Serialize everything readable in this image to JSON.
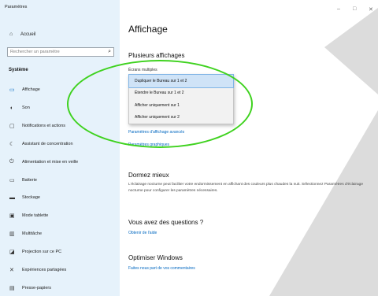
{
  "window": {
    "title": "Paramètres",
    "controls": [
      "–",
      "□",
      "✕"
    ]
  },
  "sidebar": {
    "home_label": "Accueil",
    "search_placeholder": "Rechercher un paramètre",
    "section": "Système",
    "items": [
      {
        "label": "Affichage",
        "icon": "monitor-icon"
      },
      {
        "label": "Son",
        "icon": "speaker-icon"
      },
      {
        "label": "Notifications et actions",
        "icon": "notification-icon"
      },
      {
        "label": "Assistant de concentration",
        "icon": "moon-icon"
      },
      {
        "label": "Alimentation et mise en veille",
        "icon": "power-icon"
      },
      {
        "label": "Batterie",
        "icon": "battery-icon"
      },
      {
        "label": "Stockage",
        "icon": "storage-icon"
      },
      {
        "label": "Mode tablette",
        "icon": "tablet-icon"
      },
      {
        "label": "Multitâche",
        "icon": "multitask-icon"
      },
      {
        "label": "Projection sur ce PC",
        "icon": "projection-icon"
      },
      {
        "label": "Expériences partagées",
        "icon": "shared-icon"
      },
      {
        "label": "Presse-papiers",
        "icon": "clipboard-icon"
      }
    ]
  },
  "main": {
    "title": "Affichage",
    "multi": {
      "heading": "Plusieurs affichages",
      "label": "Écrans multiples",
      "options": [
        "Dupliquer le Bureau sur 1 et 2",
        "Étendre le Bureau sur 1 et 2",
        "Afficher uniquement sur 1",
        "Afficher uniquement sur 2"
      ],
      "selected_index": 0
    },
    "links": {
      "advanced": "Paramètres d'affichage avancés",
      "graphics": "Paramètres graphiques"
    },
    "sleep": {
      "heading": "Dormez mieux",
      "text": "L'éclairage nocturne peut faciliter votre endormissement en affichant des couleurs plus chaudes la nuit. Sélectionnez Paramètres d'éclairage nocturne pour configurer les paramètres nécessaires."
    },
    "questions": {
      "heading": "Vous avez des questions ?",
      "link": "Obtenir de l'aide"
    },
    "optimize": {
      "heading": "Optimiser Windows",
      "link": "Faites nous part de vos commentaires"
    }
  }
}
